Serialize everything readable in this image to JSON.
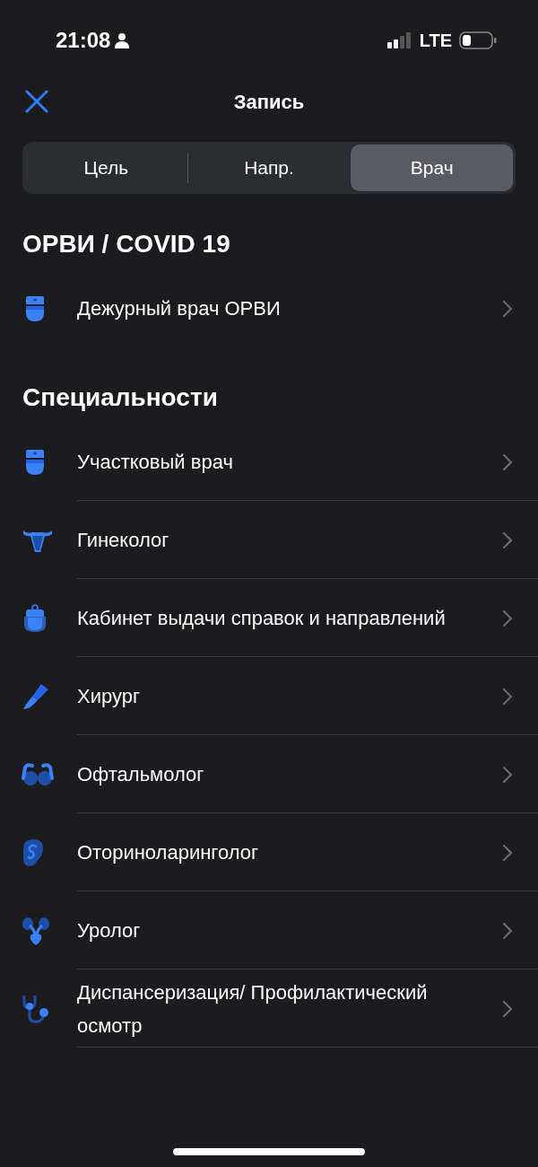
{
  "status_bar": {
    "time": "21:08",
    "network": "LTE"
  },
  "nav": {
    "title": "Запись"
  },
  "tabs": [
    {
      "label": "Цель",
      "selected": false
    },
    {
      "label": "Напр.",
      "selected": false
    },
    {
      "label": "Врач",
      "selected": true
    }
  ],
  "sections": [
    {
      "title": "ОРВИ / COVID 19",
      "items": [
        {
          "label": "Дежурный врач ОРВИ",
          "kind": "doctor"
        }
      ]
    },
    {
      "title": "Специальности",
      "items": [
        {
          "label": "Участковый врач",
          "kind": "doctor"
        },
        {
          "label": "Гинеколог",
          "kind": "uterus"
        },
        {
          "label": "Кабинет выдачи справок и направлений",
          "kind": "doctor-bag"
        },
        {
          "label": "Хирург",
          "kind": "scalpel"
        },
        {
          "label": "Офтальмолог",
          "kind": "glasses"
        },
        {
          "label": "Оториноларинголог",
          "kind": "ear"
        },
        {
          "label": "Уролог",
          "kind": "kidney"
        },
        {
          "label": "Диспансеризация/ Профилактический осмотр",
          "kind": "stethoscope"
        }
      ]
    }
  ]
}
